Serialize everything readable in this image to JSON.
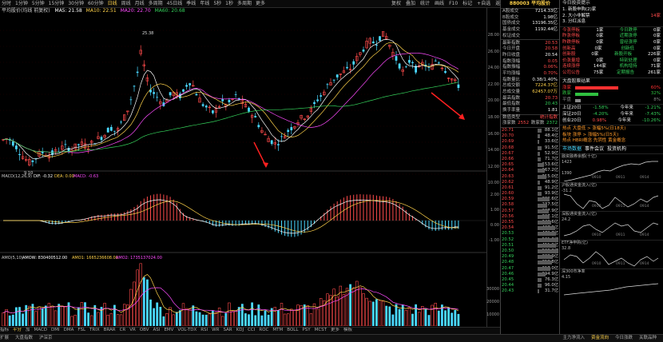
{
  "toolbar": {
    "periods": [
      "分时",
      "1分钟",
      "5分钟",
      "15分钟",
      "30分钟",
      "60分钟",
      "日线",
      "周线",
      "月线",
      "多周期",
      "45日线",
      "季线",
      "年线",
      "5秒",
      "1秒",
      "多周期",
      "更多"
    ],
    "active_index": 6,
    "right": [
      "复权",
      "叠加",
      "统计",
      "画线",
      "F10",
      "标记",
      "+自选",
      "返回"
    ]
  },
  "ma_legend": {
    "title": "平均股价(均线 前复权)",
    "ma5": "MA5: 21.58",
    "ma10": "MA10: 22.51",
    "ma20": "MA20: 22.70",
    "ma60": "MA60: 20.68"
  },
  "colors": {
    "ma5": "#ffffff",
    "ma10": "#ffd24a",
    "ma20": "#ff4bff",
    "ma60": "#34d05a",
    "up": "#ff4b4b",
    "down": "#4ad8ff"
  },
  "price_axis": [
    "28.00",
    "26.00",
    "24.00",
    "22.00",
    "20.00",
    "18.00",
    "16.00",
    "14.00",
    "12.00",
    "10.00"
  ],
  "macd_axis": [
    "2.00",
    "1.00",
    "0.00",
    "-1.00"
  ],
  "amo_axis": [
    "30000",
    "20000",
    "10000"
  ],
  "annot": {
    "high": "25.38",
    "low": "9.10"
  },
  "macd_legend": {
    "title": "MACD(12,26,9)",
    "dif": "DIF: -0.32",
    "dea": "DEA: 0.00",
    "macd": "MACD: -0.63"
  },
  "amo_legend": {
    "title": "AMO(5,10)",
    "amow": "AMOW: 830400512.00",
    "amo1": "AMO1: 1665236608.00",
    "amo2": "AMO2: 1735137024.00"
  },
  "bottom_tabs": [
    "指标",
    "平分",
    "加",
    "MACD",
    "DMI",
    "DMA",
    "FSL",
    "TRIX",
    "BRAR",
    "CR",
    "VR",
    "OBV",
    "ASI",
    "EMV",
    "VOL-TDX",
    "RSI",
    "WR",
    "SAR",
    "KDJ",
    "CCI",
    "ROC",
    "MTM",
    "BOLL",
    "PSY",
    "MCST",
    "更多",
    "模板"
  ],
  "status": {
    "left1": "扩展",
    "left2": "大盘指数",
    "left3": "沪深京",
    "right1": "主力净流入",
    "right2": "资金流向",
    "right3": "今日涨跌",
    "right4": "关联品种"
  },
  "quote": {
    "code": "880003",
    "name": "平均股价",
    "rows1": [
      [
        "A股成交",
        "7214.33亿"
      ],
      [
        "B股成交",
        "1.98亿"
      ],
      [
        "国债成交",
        "13196.35亿"
      ],
      [
        "基金成交",
        "1192.44亿"
      ],
      [
        "权证成交",
        ""
      ]
    ],
    "rows2": [
      [
        "最新指数",
        "20.53"
      ],
      [
        "今日开盘",
        "20.58"
      ],
      [
        "昨日收盘",
        "20.54"
      ],
      [
        "指数涨幅",
        "0.05"
      ],
      [
        "指数振幅",
        "0.06%"
      ],
      [
        "平均涨幅",
        "0.70%"
      ],
      [
        "指数量比",
        "0.38/1.40%"
      ],
      [
        "总成交额",
        "7224.37亿"
      ],
      [
        "总成交量",
        "62457.07万"
      ],
      [
        "最高指数",
        "20.73"
      ],
      [
        "最低指数",
        "20.43"
      ],
      [
        "换手率量",
        "1.81"
      ]
    ],
    "bs": {
      "label1": "数值类型",
      "label2": "涨家数",
      "label3": "跌家数",
      "up": "2552",
      "down": "2372"
    },
    "ticks": [
      [
        "20.71",
        "88.1亿"
      ],
      [
        "20.70",
        "48.4亿"
      ],
      [
        "20.69",
        "33.6亿"
      ],
      [
        "20.68",
        "91.5亿"
      ],
      [
        "20.67",
        "52.9亿"
      ],
      [
        "20.66",
        "71.7亿"
      ],
      [
        "20.65",
        "153.6亿"
      ],
      [
        "20.64",
        "167.2亿"
      ],
      [
        "20.63",
        "215.0亿"
      ],
      [
        "20.62",
        "48.9亿"
      ],
      [
        "20.61",
        "91.2亿"
      ],
      [
        "20.60",
        "93.9亿"
      ],
      [
        "20.59",
        "302.6亿"
      ],
      [
        "20.58",
        "237.5亿"
      ],
      [
        "20.57",
        "287.9亿"
      ],
      [
        "20.56",
        "307.1亿"
      ],
      [
        "20.55",
        "343.6亿"
      ],
      [
        "20.54",
        "437.9亿"
      ],
      [
        "20.53",
        "472.7亿"
      ],
      [
        "20.52",
        "531.8亿"
      ],
      [
        "20.51",
        "451.9亿"
      ],
      [
        "20.50",
        "526.0亿"
      ],
      [
        "20.49",
        "388.9亿"
      ],
      [
        "20.48",
        "358.8亿"
      ],
      [
        "20.47",
        "317.0亿"
      ],
      [
        "20.46",
        "194.9亿"
      ],
      [
        "20.45",
        "76.3亿"
      ],
      [
        "20.44",
        "96.0亿"
      ],
      [
        "20.43",
        "31.7亿"
      ]
    ],
    "tick_bars": [
      10,
      7,
      5,
      11,
      7,
      9,
      18,
      20,
      25,
      7,
      11,
      12,
      34,
      27,
      32,
      34,
      38,
      48,
      52,
      58,
      50,
      57,
      43,
      40,
      35,
      22,
      10,
      12,
      5
    ]
  },
  "info": {
    "title": "今日投资提示",
    "tips": [
      [
        "1. 新股申购(2)家",
        ""
      ],
      [
        "2. 大小非解禁",
        "14家"
      ],
      [
        "3. 分红派息",
        ""
      ]
    ],
    "stats": [
      [
        "今涨停板",
        "1家",
        "今日跌停",
        "0家"
      ],
      [
        "昨涨停板",
        "0家",
        "近期涨停",
        "0家"
      ],
      [
        "昨跌停板",
        "0家",
        "曾经涨停",
        "0家"
      ],
      [
        "创新高",
        "0家",
        "创新低",
        "0家"
      ],
      [
        "创新股",
        "0家",
        "新股开板",
        "226家"
      ],
      [
        "价涨量增",
        "0家",
        "特别处理",
        "0家"
      ],
      [
        "连续涨停",
        "144家",
        "机构增持",
        "71家"
      ],
      [
        "公司公告",
        "75家",
        "定期报告",
        "261家"
      ]
    ],
    "dp_title": "大盘股票结果",
    "dp": [
      [
        "涨家",
        "60%"
      ],
      [
        "跌家",
        "32%"
      ],
      [
        "平盘",
        "8%"
      ]
    ],
    "ma": [
      [
        "上证20日",
        "-1.58%",
        "今年来",
        "-1.21%"
      ],
      [
        "深证20日",
        "-4.20%",
        "今年来",
        "-7.43%"
      ],
      [
        "创业20日",
        "0.98%",
        "今年来",
        "-10.26%"
      ]
    ],
    "hot1": "热点 大盘低 > 涨幅5%(日18天)",
    "hot2": "板块 涨停 > 涨幅5%(日5天)",
    "hot3": "热点 HBRI概念 先阴性 黄金概念",
    "tabs": [
      "市场数据",
      "事件会议",
      "投资机构"
    ],
    "minis": [
      [
        "融资融券余额(十亿)",
        "1423",
        "1390",
        "0910",
        "0911",
        "0914"
      ],
      [
        "沪股通资金流入(亿)",
        "-31.2",
        "0910",
        "0911",
        "0914"
      ],
      [
        "深股通资金流入(亿)",
        "24.2",
        "0910",
        "0911",
        "0914"
      ],
      [
        "ETF净申购(亿)",
        "32.8",
        "0910",
        "0911",
        "0914"
      ],
      [
        "深300市净率",
        "4.15"
      ]
    ]
  }
}
